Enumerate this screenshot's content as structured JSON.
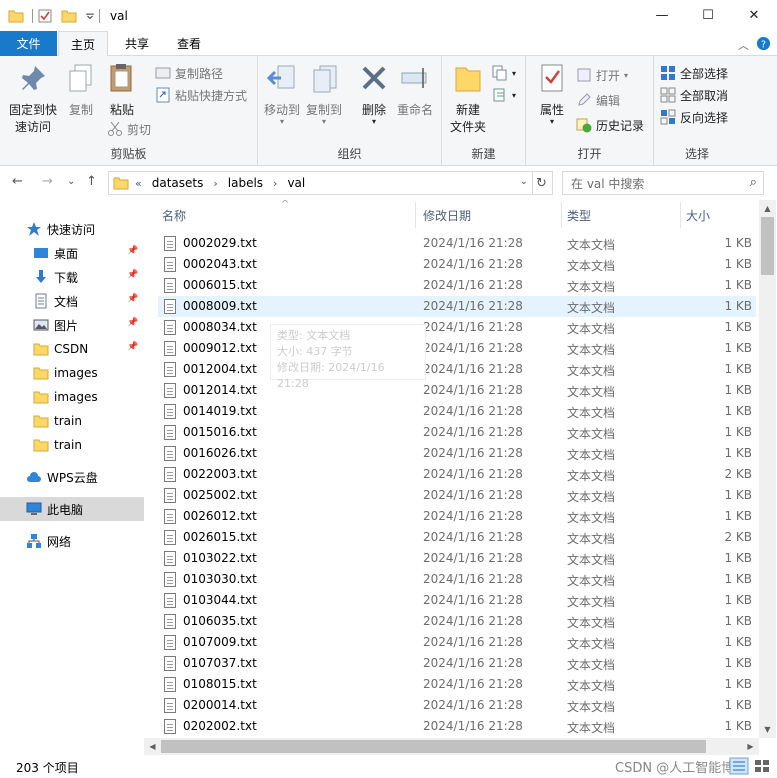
{
  "window": {
    "title": "val",
    "controls": [
      "—",
      "☐",
      "✕"
    ]
  },
  "ribbon_tabs": {
    "file": "文件",
    "home": "主页",
    "share": "共享",
    "view": "查看"
  },
  "ribbon": {
    "clipboard": {
      "label": "剪贴板",
      "pin": "固定到快\n速访问",
      "copy": "复制",
      "paste": "粘贴",
      "copy_path": "复制路径",
      "paste_shortcut": "粘贴快捷方式",
      "cut": "剪切"
    },
    "organize": {
      "label": "组织",
      "move_to": "移动到",
      "copy_to": "复制到",
      "delete": "删除",
      "rename": "重命名"
    },
    "new": {
      "label": "新建",
      "new_folder": "新建\n文件夹"
    },
    "open": {
      "label": "打开",
      "properties": "属性",
      "open": "打开",
      "edit": "编辑",
      "history": "历史记录"
    },
    "select": {
      "label": "选择",
      "select_all": "全部选择",
      "select_none": "全部取消",
      "invert": "反向选择"
    }
  },
  "address": {
    "crumbs": [
      "datasets",
      "labels",
      "val"
    ],
    "search_placeholder": "在 val 中搜索"
  },
  "nav_pane": {
    "quick_access": "快速访问",
    "items": [
      {
        "label": "桌面",
        "icon": "desktop-icon",
        "pinned": true
      },
      {
        "label": "下载",
        "icon": "download-icon",
        "pinned": true
      },
      {
        "label": "文档",
        "icon": "document-icon",
        "pinned": true
      },
      {
        "label": "图片",
        "icon": "pictures-icon",
        "pinned": true
      },
      {
        "label": "CSDN",
        "icon": "folder-icon",
        "pinned": true
      },
      {
        "label": "images",
        "icon": "folder-icon",
        "pinned": false
      },
      {
        "label": "images",
        "icon": "folder-icon",
        "pinned": false
      },
      {
        "label": "train",
        "icon": "folder-icon",
        "pinned": false
      },
      {
        "label": "train",
        "icon": "folder-icon",
        "pinned": false
      }
    ],
    "wps": "WPS云盘",
    "this_pc": "此电脑",
    "network": "网络"
  },
  "columns": {
    "name": "名称",
    "date": "修改日期",
    "type": "类型",
    "size": "大小"
  },
  "files": [
    {
      "name": "0002029.txt",
      "date": "2024/1/16 21:28",
      "type": "文本文档",
      "size": "1 KB"
    },
    {
      "name": "0002043.txt",
      "date": "2024/1/16 21:28",
      "type": "文本文档",
      "size": "1 KB"
    },
    {
      "name": "0006015.txt",
      "date": "2024/1/16 21:28",
      "type": "文本文档",
      "size": "1 KB"
    },
    {
      "name": "0008009.txt",
      "date": "2024/1/16 21:28",
      "type": "文本文档",
      "size": "1 KB"
    },
    {
      "name": "0008034.txt",
      "date": "2024/1/16 21:28",
      "type": "文本文档",
      "size": "1 KB"
    },
    {
      "name": "0009012.txt",
      "date": "2024/1/16 21:28",
      "type": "文本文档",
      "size": "1 KB"
    },
    {
      "name": "0012004.txt",
      "date": "2024/1/16 21:28",
      "type": "文本文档",
      "size": "1 KB"
    },
    {
      "name": "0012014.txt",
      "date": "2024/1/16 21:28",
      "type": "文本文档",
      "size": "1 KB"
    },
    {
      "name": "0014019.txt",
      "date": "2024/1/16 21:28",
      "type": "文本文档",
      "size": "1 KB"
    },
    {
      "name": "0015016.txt",
      "date": "2024/1/16 21:28",
      "type": "文本文档",
      "size": "1 KB"
    },
    {
      "name": "0016026.txt",
      "date": "2024/1/16 21:28",
      "type": "文本文档",
      "size": "1 KB"
    },
    {
      "name": "0022003.txt",
      "date": "2024/1/16 21:28",
      "type": "文本文档",
      "size": "2 KB"
    },
    {
      "name": "0025002.txt",
      "date": "2024/1/16 21:28",
      "type": "文本文档",
      "size": "1 KB"
    },
    {
      "name": "0026012.txt",
      "date": "2024/1/16 21:28",
      "type": "文本文档",
      "size": "1 KB"
    },
    {
      "name": "0026015.txt",
      "date": "2024/1/16 21:28",
      "type": "文本文档",
      "size": "2 KB"
    },
    {
      "name": "0103022.txt",
      "date": "2024/1/16 21:28",
      "type": "文本文档",
      "size": "1 KB"
    },
    {
      "name": "0103030.txt",
      "date": "2024/1/16 21:28",
      "type": "文本文档",
      "size": "1 KB"
    },
    {
      "name": "0103044.txt",
      "date": "2024/1/16 21:28",
      "type": "文本文档",
      "size": "1 KB"
    },
    {
      "name": "0106035.txt",
      "date": "2024/1/16 21:28",
      "type": "文本文档",
      "size": "1 KB"
    },
    {
      "name": "0107009.txt",
      "date": "2024/1/16 21:28",
      "type": "文本文档",
      "size": "1 KB"
    },
    {
      "name": "0107037.txt",
      "date": "2024/1/16 21:28",
      "type": "文本文档",
      "size": "1 KB"
    },
    {
      "name": "0108015.txt",
      "date": "2024/1/16 21:28",
      "type": "文本文档",
      "size": "1 KB"
    },
    {
      "name": "0200014.txt",
      "date": "2024/1/16 21:28",
      "type": "文本文档",
      "size": "1 KB"
    },
    {
      "name": "0202002.txt",
      "date": "2024/1/16 21:28",
      "type": "文本文档",
      "size": "1 KB"
    }
  ],
  "hovered_row": 3,
  "tooltip": {
    "type": "类型: 文本文档",
    "size": "大小: 437 字节",
    "modified": "修改日期: 2024/1/16 21:28"
  },
  "status": {
    "count": "203 个项目",
    "watermark": "CSDN @人工智能博士"
  },
  "colors": {
    "file_tab": "#1979ca",
    "hover_row": "#e5f3ff",
    "folder": "#ffd769",
    "header_text": "#4c607a"
  }
}
